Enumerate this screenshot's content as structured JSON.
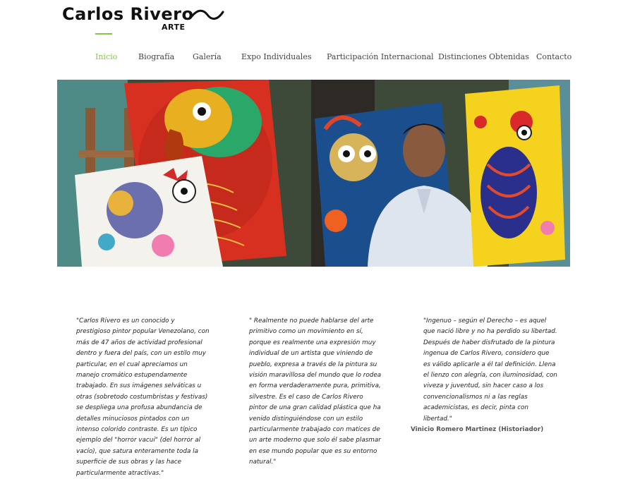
{
  "logo": {
    "name": "Carlos Rivero",
    "subtitle": "ARTE"
  },
  "nav": {
    "items": [
      {
        "label": "Inicio",
        "active": true
      },
      {
        "label": "Biografía"
      },
      {
        "label": "Galería"
      },
      {
        "label": "Expo Individuales"
      },
      {
        "label": "Participación Internacional"
      },
      {
        "label": "Distinciones Obtenidas"
      },
      {
        "label": "Contacto"
      }
    ]
  },
  "quotes": [
    {
      "text": "\"Carlos Rivero es un conocido y prestigioso pintor popular Venezolano, con más de 47 años de actividad profesional dentro y fuera del país, con un estilo muy particular, en el cual apreciamos un manejo cromático estupendamente trabajado. En sus imágenes selváticas u otras (sobretodo costumbristas y festivas) se despliega una profusa abundancia de detalles minuciosos pintados con un intenso colorido contraste. Es un típico ejemplo del \"horror vacui\" (del horror al vacío), que satura enteramente toda la superficie de sus obras y las hace particularmente atractivas.\""
    },
    {
      "text": "\" Realmente no puede hablarse del arte primitivo como un movimiento en sí, porque es realmente una expresión muy individual de un artista que viniendo de pueblo, expresa a través de la pintura su visión maravillosa del mundo que lo rodea en forma verdaderamente pura, primitiva, silvestre. Es el caso de Carlos Rivero pintor de una gran calidad plástica que ha venido distinguiéndose con un estilo particularmente trabajado con matices de un arte moderno que solo él sabe plasmar en ese mundo popular que es su entorno natural.\""
    },
    {
      "text": "\"Ingenuo – según el Derecho – es aquel que nació libre y no ha perdido su libertad. Después de haber disfrutado de la pintura ingenua de Carlos Rivero, considero que es válido aplicarle a él tal definición. Llena el lienzo con alegría, con iluminosidad, con viveza y juventud, sin hacer caso a los convencionalismos ni a las reglas academicistas, es decir, pinta con libertad.\"",
      "author": "Vinicio Romero Martinez (Historiador)"
    }
  ],
  "colors": {
    "accent": "#8bc34a",
    "text": "#222222",
    "nav": "#444444"
  }
}
